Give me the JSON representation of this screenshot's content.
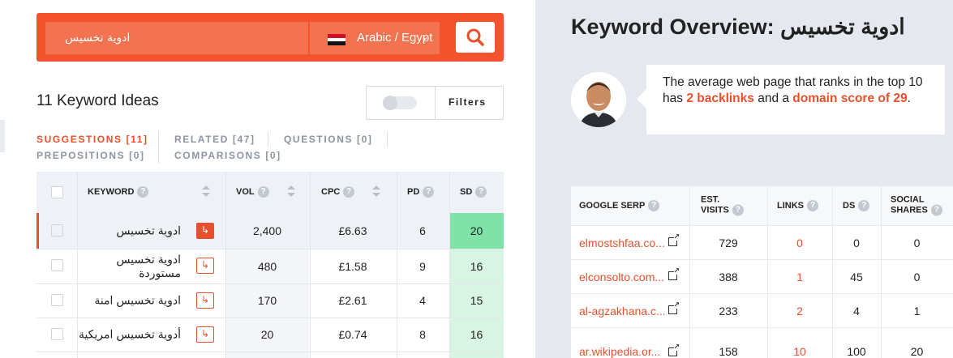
{
  "search": {
    "keyword": "ادوية تخسيس",
    "language": "Arabic / Egypt",
    "flag": "egypt-flag",
    "button_icon": "search-icon"
  },
  "ideas": {
    "title": "11 Keyword Ideas",
    "filters_label": "Filters",
    "tabs": [
      {
        "label": "SUGGESTIONS [11]",
        "active": true
      },
      {
        "label": "RELATED [47]",
        "active": false
      },
      {
        "label": "QUESTIONS [0]",
        "active": false
      },
      {
        "label": "PREPOSITIONS [0]",
        "active": false
      },
      {
        "label": "COMPARISONS [0]",
        "active": false
      }
    ]
  },
  "table": {
    "headers": {
      "keyword": "KEYWORD",
      "vol": "VOL",
      "cpc": "CPC",
      "pd": "PD",
      "sd": "SD"
    },
    "rows": [
      {
        "keyword": "ادوية تخسيس",
        "vol": "2,400",
        "cpc": "£6.63",
        "pd": "6",
        "sd": "20"
      },
      {
        "keyword": "ادوية تخسيس مستوردة",
        "vol": "480",
        "cpc": "£1.58",
        "pd": "9",
        "sd": "16"
      },
      {
        "keyword": "ادوية تخسيس امنة",
        "vol": "170",
        "cpc": "£2.61",
        "pd": "4",
        "sd": "15"
      },
      {
        "keyword": "أدوية تخسيس امريكية",
        "vol": "20",
        "cpc": "£0.74",
        "pd": "8",
        "sd": "16"
      }
    ]
  },
  "overview": {
    "title": "Keyword Overview: ادوية تخسيس",
    "bubble": {
      "prefix": "The average web page that ranks in the top 10 has ",
      "backlinks": "2 backlinks",
      "middle": " and a ",
      "score": "domain score of 29",
      "suffix": "."
    }
  },
  "serp": {
    "headers": {
      "serp": "GOOGLE SERP",
      "visits_1": "EST.",
      "visits_2": "VISITS",
      "links": "LINKS",
      "ds": "DS",
      "social_1": "SOCIAL",
      "social_2": "SHARES"
    },
    "rows": [
      {
        "url": "elmostshfaa.co...",
        "visits": "729",
        "links": "0",
        "ds": "0",
        "shares": "0"
      },
      {
        "url": "elconsolto.com...",
        "visits": "388",
        "links": "1",
        "ds": "45",
        "shares": "0"
      },
      {
        "url": "al-agzakhana.c...",
        "visits": "233",
        "links": "2",
        "ds": "4",
        "shares": "1"
      },
      {
        "url": "ar.wikipedia.or...",
        "visits": "158",
        "links": "10",
        "ds": "100",
        "shares": "20"
      }
    ]
  },
  "colors": {
    "accent": "#e8502d",
    "sd_high": "#7fe3a7",
    "sd_low": "#d7f5e2"
  }
}
